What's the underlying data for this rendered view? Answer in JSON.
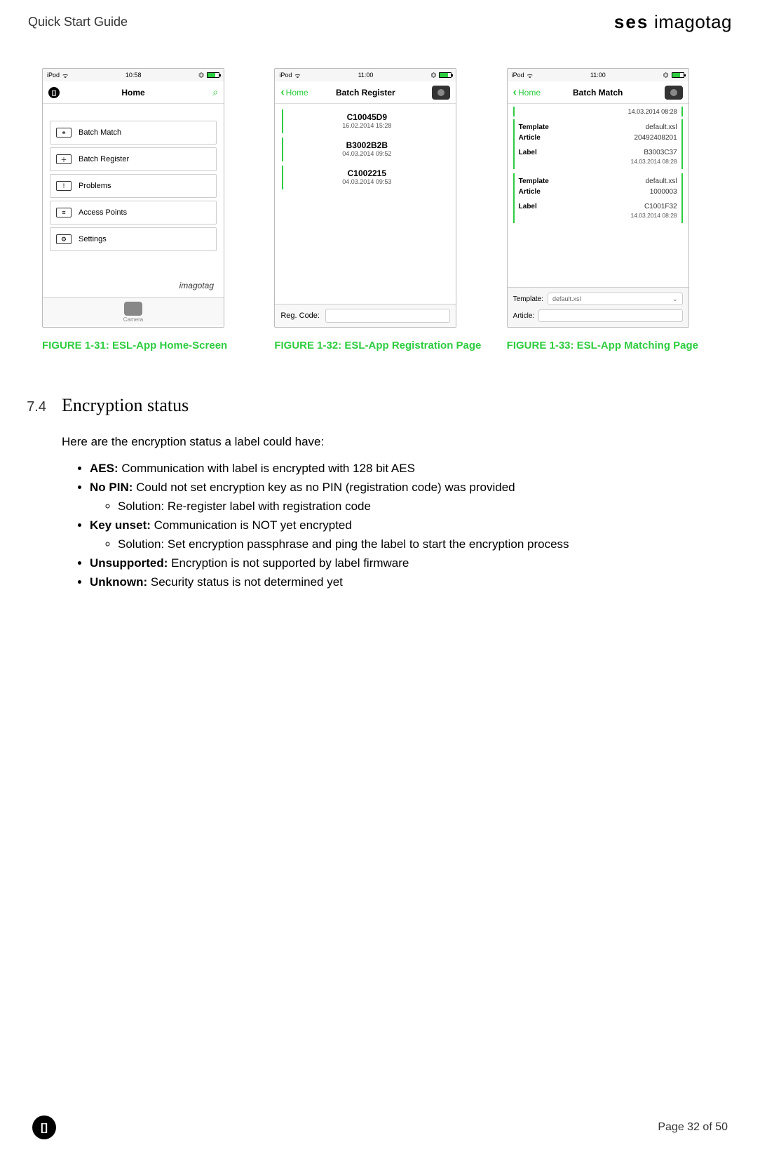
{
  "header": {
    "doc_title": "Quick Start Guide",
    "brand_a": "ses",
    "brand_b": "imagotag"
  },
  "figures": {
    "f1": {
      "status_time": "10:58",
      "status_device": "iPod",
      "nav_title": "Home",
      "menu": [
        "Batch Match",
        "Batch Register",
        "Problems",
        "Access Points",
        "Settings"
      ],
      "watermark": "imagotag",
      "camera_label": "Camera",
      "caption": "FIGURE 1-31: ESL-App Home-Screen"
    },
    "f2": {
      "status_time": "11:00",
      "status_device": "iPod",
      "back_label": "Home",
      "nav_title": "Batch Register",
      "items": [
        {
          "code": "C10045D9",
          "date": "16.02.2014 15:28"
        },
        {
          "code": "B3002B2B",
          "date": "04.03.2014 09:52"
        },
        {
          "code": "C1002215",
          "date": "04.03.2014 09:53"
        }
      ],
      "footer_label": "Reg. Code:",
      "caption": "FIGURE 1-32: ESL-App Registration Page"
    },
    "f3": {
      "status_time": "11:00",
      "status_device": "iPod",
      "back_label": "Home",
      "nav_title": "Batch Match",
      "header_ts": "14.03.2014 08:28",
      "cards": [
        {
          "template": "default.xsl",
          "article": "20492408201",
          "label": "B3003C37",
          "ts": "14.03.2014 08:28"
        },
        {
          "template": "default.xsl",
          "article": "1000003",
          "label": "C1001F32",
          "ts": "14.03.2014 08:28"
        }
      ],
      "k_template": "Template",
      "k_article": "Article",
      "k_label": "Label",
      "footer_template_label": "Template:",
      "footer_template_value": "default.xsl",
      "footer_article_label": "Article:",
      "caption": "FIGURE 1-33: ESL-App Matching Page"
    }
  },
  "section": {
    "number": "7.4",
    "title": "Encryption status",
    "intro": "Here are the encryption status a label could have:",
    "items": {
      "aes_k": "AES:",
      "aes_v": " Communication with label is encrypted with 128 bit AES",
      "nopin_k": "No PIN:",
      "nopin_v": " Could not set encryption key as no PIN (registration code) was provided",
      "nopin_sol": "Solution: Re-register label with registration code",
      "key_k": "Key  unset:",
      "key_v": " Communication is NOT yet encrypted",
      "key_sol": "Solution: Set encryption passphrase and ping the label to start the encryption pro­cess",
      "unsup_k": "Unsupported:",
      "unsup_v": " Encryption is not supported by label firmware",
      "unk_k": "Unknown:",
      "unk_v": " Security status is not determined yet"
    }
  },
  "footer": {
    "logo_text": "[]",
    "page": "Page 32 of 50"
  }
}
